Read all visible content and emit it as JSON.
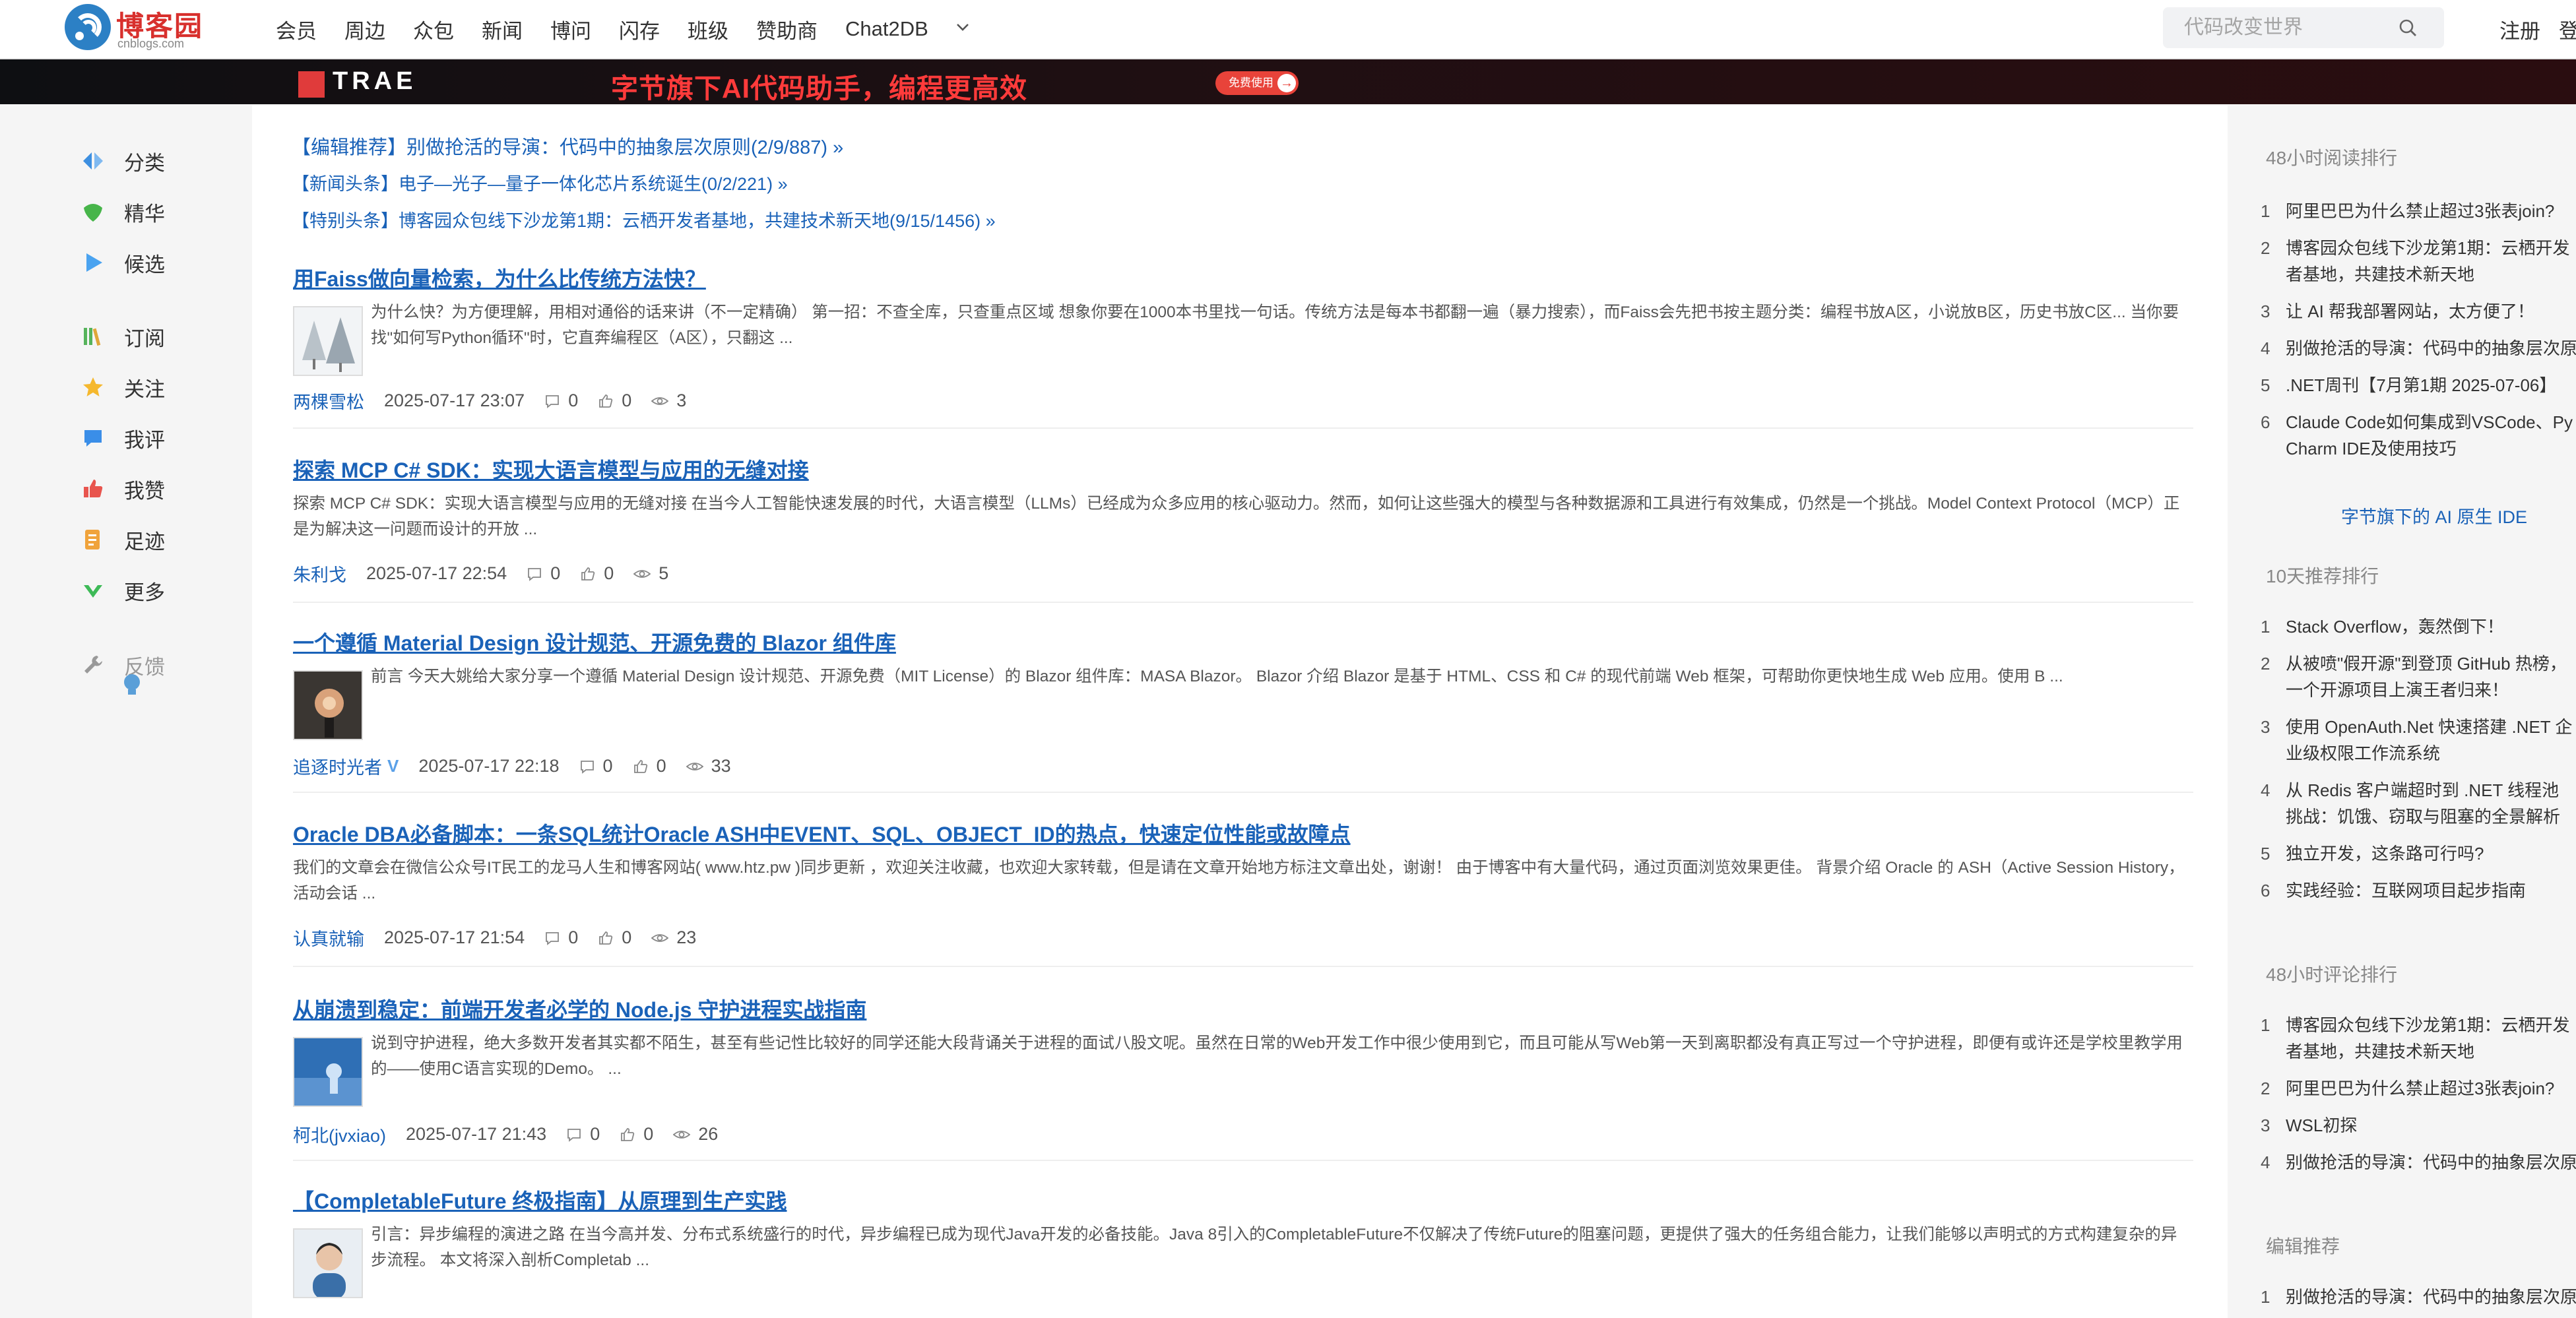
{
  "header": {
    "logo_text": "博客园",
    "logo_sub": "cnblogs.com",
    "nav": [
      "会员",
      "周边",
      "众包",
      "新闻",
      "博问",
      "闪存",
      "班级",
      "赞助商",
      "Chat2DB"
    ],
    "search_placeholder": "代码改变世界",
    "register": "注册",
    "login": "登"
  },
  "banner": {
    "brand": "TRAE",
    "slogan": "字节旗下AI代码助手，编程更高效",
    "cta": "免费使用"
  },
  "sidebar": {
    "items": [
      {
        "label": "分类",
        "icon": "category-icon"
      },
      {
        "label": "精华",
        "icon": "gem-icon"
      },
      {
        "label": "候选",
        "icon": "play-icon"
      },
      {
        "label": "订阅",
        "icon": "books-icon"
      },
      {
        "label": "关注",
        "icon": "star-icon"
      },
      {
        "label": "我评",
        "icon": "comment-icon"
      },
      {
        "label": "我赞",
        "icon": "thumb-up-icon"
      },
      {
        "label": "足迹",
        "icon": "footprint-icon"
      },
      {
        "label": "更多",
        "icon": "more-icon"
      },
      {
        "label": "反馈",
        "icon": "wrench-icon"
      }
    ]
  },
  "headlines": [
    "【编辑推荐】别做抢活的导演：代码中的抽象层次原则(2/9/887) »",
    "【新闻头条】电子—光子—量子一体化芯片系统诞生(0/2/221) »",
    "【特别头条】博客园众包线下沙龙第1期：云栖开发者基地，共建技术新天地(9/15/1456) »"
  ],
  "posts": [
    {
      "title": "用Faiss做向量检索，为什么比传统方法快？",
      "summary": "为什么快？为方便理解，用相对通俗的话来讲（不一定精确） 第一招：不查全库，只查重点区域 想象你要在1000本书里找一句话。传统方法是每本书都翻一遍（暴力搜索），而Faiss会先把书按主题分类：编程书放A区，小说放B区，历史书放C区... 当你要找\"如何写Python循环\"时，它直奔编程区（A区），只翻这 ...",
      "author": "两棵雪松",
      "date": "2025-07-17 23:07",
      "comments": "0",
      "likes": "0",
      "views": "3"
    },
    {
      "title": "探索 MCP C# SDK：实现大语言模型与应用的无缝对接",
      "summary": "探索 MCP C# SDK：实现大语言模型与应用的无缝对接 在当今人工智能快速发展的时代，大语言模型（LLMs）已经成为众多应用的核心驱动力。然而，如何让这些强大的模型与各种数据源和工具进行有效集成，仍然是一个挑战。Model Context Protocol（MCP）正是为解决这一问题而设计的开放 ...",
      "author": "朱利戈",
      "date": "2025-07-17 22:54",
      "comments": "0",
      "likes": "0",
      "views": "5"
    },
    {
      "title": "一个遵循 Material Design 设计规范、开源免费的 Blazor 组件库",
      "summary": "前言 今天大姚给大家分享一个遵循 Material Design 设计规范、开源免费（MIT License）的 Blazor 组件库：MASA Blazor。 Blazor 介绍 Blazor 是基于 HTML、CSS 和 C# 的现代前端 Web 框架，可帮助你更快地生成 Web 应用。使用 B ...",
      "author": "追逐时光者",
      "verified": "V",
      "date": "2025-07-17 22:18",
      "comments": "0",
      "likes": "0",
      "views": "33"
    },
    {
      "title": "Oracle DBA必备脚本：一条SQL统计Oracle ASH中EVENT、SQL、OBJECT_ID的热点，快速定位性能或故障点",
      "summary": "我们的文章会在微信公众号IT民工的龙马人生和博客网站( www.htz.pw )同步更新 ，欢迎关注收藏，也欢迎大家转载，但是请在文章开始地方标注文章出处，谢谢！ 由于博客中有大量代码，通过页面浏览效果更佳。 背景介绍 Oracle 的 ASH（Active Session History，活动会话 ...",
      "author": "认真就输",
      "date": "2025-07-17 21:54",
      "comments": "0",
      "likes": "0",
      "views": "23"
    },
    {
      "title": "从崩溃到稳定：前端开发者必学的 Node.js 守护进程实战指南",
      "summary": "说到守护进程，绝大多数开发者其实都不陌生，甚至有些记性比较好的同学还能大段背诵关于进程的面试八股文呢。虽然在日常的Web开发工作中很少使用到它，而且可能从写Web第一天到离职都没有真正写过一个守护进程，即便有或许还是学校里教学用的——使用C语言实现的Demo。 ...",
      "author": "柯北(jvxiao)",
      "date": "2025-07-17 21:43",
      "comments": "0",
      "likes": "0",
      "views": "26"
    },
    {
      "title": "【CompletableFuture 终极指南】从原理到生产实践",
      "summary": "引言：异步编程的演进之路 在当今高并发、分布式系统盛行的时代，异步编程已成为现代Java开发的必备技能。Java 8引入的CompletableFuture不仅解决了传统Future的阻塞问题，更提供了强大的任务组合能力，让我们能够以声明式的方式构建复杂的异步流程。 本文将深入剖析Completab ..."
    }
  ],
  "right": {
    "read48_title": "48小时阅读排行",
    "read48": [
      "阿里巴巴为什么禁止超过3张表join?",
      "博客园众包线下沙龙第1期：云栖开发者基地，共建技术新天地",
      "让 AI 帮我部署网站，太方便了！",
      "别做抢活的导演：代码中的抽象层次原",
      ".NET周刊【7月第1期 2025-07-06】",
      "Claude Code如何集成到VSCode、PyCharm IDE及使用技巧"
    ],
    "ad": "字节旗下的 AI 原生 IDE",
    "rec10_title": "10天推荐排行",
    "rec10": [
      "Stack Overflow，轰然倒下！",
      "从被喷\"假开源\"到登顶 GitHub 热榜，一个开源项目上演王者归来！",
      "使用 OpenAuth.Net 快速搭建 .NET 企业级权限工作流系统",
      "从 Redis 客户端超时到 .NET 线程池挑战：饥饿、窃取与阻塞的全景解析",
      "独立开发，这条路可行吗?",
      "实践经验：互联网项目起步指南"
    ],
    "comment48_title": "48小时评论排行",
    "comment48": [
      "博客园众包线下沙龙第1期：云栖开发者基地，共建技术新天地",
      "阿里巴巴为什么禁止超过3张表join?",
      "WSL初探",
      "别做抢活的导演：代码中的抽象层次原"
    ],
    "editor_title": "编辑推荐",
    "editor": [
      "别做抢活的导演：代码中的抽象层次原"
    ]
  }
}
